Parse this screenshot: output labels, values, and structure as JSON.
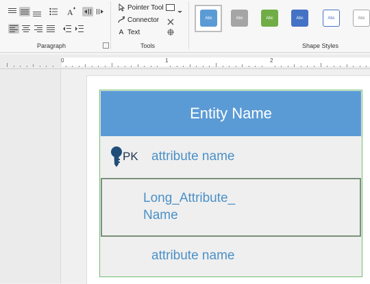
{
  "ribbon": {
    "paragraph": {
      "group_label": "Paragraph"
    },
    "tools": {
      "group_label": "Tools",
      "pointer_tool": "Pointer Tool",
      "connector": "Connector",
      "text": "Text",
      "text_icon_glyph": "A"
    },
    "shape_styles": {
      "group_label": "Shape Styles",
      "swatch_label": "Abc",
      "swatches": [
        {
          "label": "Abc",
          "fill": "#5b9bd5",
          "text": "#ffffff",
          "border": "#5b9bd5",
          "selected": true
        },
        {
          "label": "Abc",
          "fill": "#a5a5a5",
          "text": "#ffffff",
          "border": "#a5a5a5"
        },
        {
          "label": "Abc",
          "fill": "#70ad47",
          "text": "#ffffff",
          "border": "#70ad47"
        },
        {
          "label": "Abc",
          "fill": "#4472c4",
          "text": "#ffffff",
          "border": "#4472c4"
        },
        {
          "label": "Abc",
          "fill": "#ffffff",
          "text": "#4472c4",
          "border": "#4472c4"
        },
        {
          "label": "Abc",
          "fill": "#ffffff",
          "text": "#7f7f7f",
          "border": "#a5a5a5"
        }
      ]
    }
  },
  "ruler": {
    "marks": [
      "0",
      "1",
      "2"
    ]
  },
  "entity": {
    "title": "Entity Name",
    "header_color": "#5b9bd5",
    "rows": [
      {
        "key": "PK",
        "label": "attribute name"
      },
      {
        "key": "",
        "label_line1": "Long_Attribute_",
        "label_line2": "Name"
      },
      {
        "key": "",
        "label": "attribute name"
      }
    ]
  }
}
